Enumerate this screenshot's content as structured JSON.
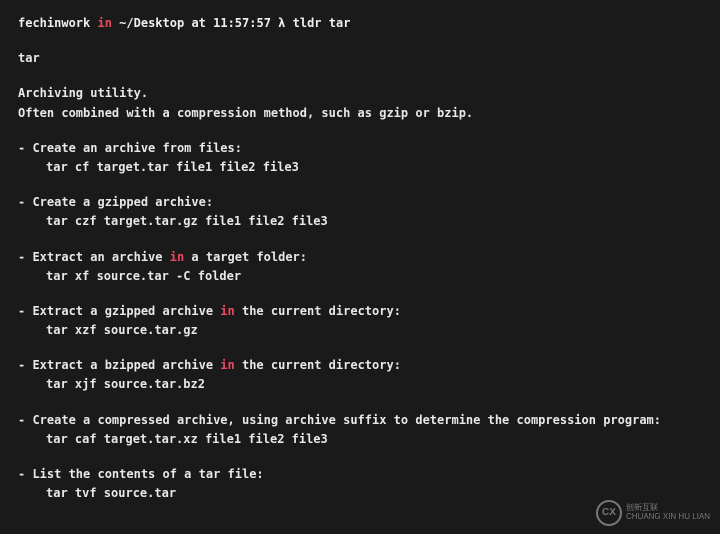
{
  "prompt": {
    "user": "fechinwork",
    "in": "in",
    "path": "~/Desktop",
    "at": "at",
    "time": "11:57:57",
    "lambda": "λ",
    "command": "tldr tar"
  },
  "output": {
    "name": "tar",
    "desc1": "Archiving utility.",
    "desc2": "Often combined with a compression method, such as gzip or bzip.",
    "examples": [
      {
        "title_parts": [
          "- Create an archive from files:"
        ],
        "cmd": "tar cf target.tar file1 file2 file3"
      },
      {
        "title_parts": [
          "- Create a gzipped archive:"
        ],
        "cmd": "tar czf target.tar.gz file1 file2 file3"
      },
      {
        "title_parts": [
          "- Extract an archive ",
          "in",
          " a target folder:"
        ],
        "cmd": "tar xf source.tar -C folder"
      },
      {
        "title_parts": [
          "- Extract a gzipped archive ",
          "in",
          " the current directory:"
        ],
        "cmd": "tar xzf source.tar.gz"
      },
      {
        "title_parts": [
          "- Extract a bzipped archive ",
          "in",
          " the current directory:"
        ],
        "cmd": "tar xjf source.tar.bz2"
      },
      {
        "title_parts": [
          "- Create a compressed archive, using archive suffix to determine the compression program:"
        ],
        "cmd": "tar caf target.tar.xz file1 file2 file3"
      },
      {
        "title_parts": [
          "- List the contents of a tar file:"
        ],
        "cmd": "tar tvf source.tar"
      }
    ]
  },
  "watermark": {
    "icon": "CX",
    "line1": "创新互联",
    "line2": "CHUANG XIN HU LIAN"
  }
}
